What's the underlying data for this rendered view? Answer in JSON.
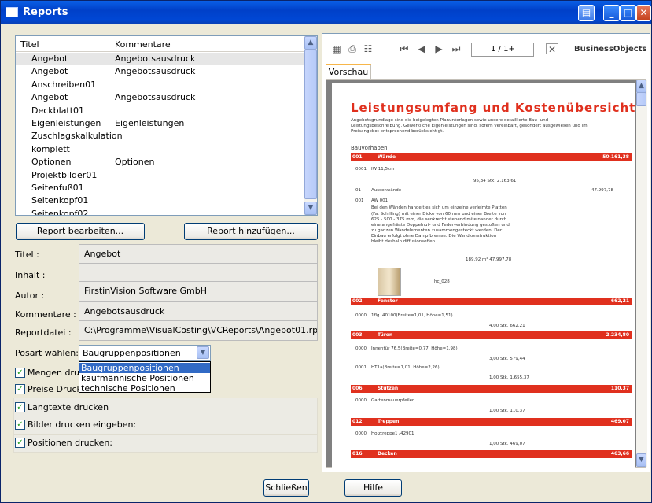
{
  "window": {
    "title": "Reports"
  },
  "list": {
    "col_title": "Titel",
    "col_comment": "Kommentare",
    "rows": [
      {
        "title": "Angebot",
        "comment": "Angebotsausdruck"
      },
      {
        "title": "Angebot",
        "comment": "Angebotsausdruck"
      },
      {
        "title": "Anschreiben01",
        "comment": ""
      },
      {
        "title": "Angebot",
        "comment": "Angebotsausdruck"
      },
      {
        "title": "Deckblatt01",
        "comment": ""
      },
      {
        "title": "Eigenleistungen",
        "comment": "Eigenleistungen"
      },
      {
        "title": "Zuschlagskalkulation",
        "comment": ""
      },
      {
        "title": "komplett",
        "comment": ""
      },
      {
        "title": "Optionen",
        "comment": "Optionen"
      },
      {
        "title": "Projektbilder01",
        "comment": ""
      },
      {
        "title": "Seitenfuß01",
        "comment": ""
      },
      {
        "title": "Seitenkopf01",
        "comment": ""
      },
      {
        "title": "Seitenkopf02",
        "comment": ""
      }
    ]
  },
  "buttons": {
    "edit": "Report bearbeiten...",
    "add": "Report hinzufügen...",
    "close": "Schließen",
    "help": "Hilfe"
  },
  "fields": {
    "title_label": "Titel :",
    "title_value": "Angebot",
    "content_label": "Inhalt :",
    "content_value": "",
    "author_label": "Autor :",
    "author_value": "FirstinVision Software GmbH",
    "comment_label": "Kommentare :",
    "comment_value": "Angebotsausdruck",
    "file_label": "Reportdatei :",
    "file_value": "C:\\Programme\\VisualCosting\\VCReports\\Angebot01.rpt"
  },
  "posart": {
    "label": "Posart wählen:",
    "selected": "Baugruppenpositionen",
    "options": [
      "Baugruppenpositionen",
      "kaufmännische Positionen",
      "technische Positionen"
    ]
  },
  "checkboxes": [
    {
      "label": "Mengen drucken",
      "checked": true
    },
    {
      "label": "Preise Drucken",
      "checked": true
    },
    {
      "label": "Langtexte drucken",
      "checked": true
    },
    {
      "label": "Bilder drucken eingeben:",
      "checked": true
    },
    {
      "label": "Positionen drucken:",
      "checked": true
    }
  ],
  "viewer": {
    "page_box": "1 / 1+",
    "brand": "BusinessObjects",
    "tab": "Vorschau",
    "report": {
      "title": "Leistungsumfang und Kostenübersicht",
      "intro1": "Angebotsgrundlage sind die beigelegten Planunterlagen sowie unsere detaillierte Bau- und",
      "intro2": "Leistungsbeschreibung. Gewerkliche Eigenleistungen sind, sofern vereinbart, gesondert ausgewiesen und im",
      "intro3": "Preisangebot entsprechend berücksichtigt.",
      "section_head": "Bauvorhaben",
      "sections": [
        {
          "no": "001",
          "name": "Wände",
          "sum": "50.161,38"
        },
        {
          "no": "002",
          "name": "Fenster",
          "sum": "662,21"
        },
        {
          "no": "003",
          "name": "Türen",
          "sum": "2.234,80"
        },
        {
          "no": "006",
          "name": "Stützen",
          "sum": "110,37"
        },
        {
          "no": "012",
          "name": "Treppen",
          "sum": "469,07"
        },
        {
          "no": "016",
          "name": "Decken",
          "sum": "463,66"
        }
      ],
      "lines": [
        {
          "a": "0001",
          "b": "IW 11,5cm"
        },
        {
          "a": "",
          "b": "95,34 Stk.        2.163,61"
        },
        {
          "a": "01",
          "b": "Aussenwände"
        },
        {
          "a": "",
          "b": "47.997,78"
        },
        {
          "a": "001",
          "b": "AW 001"
        },
        {
          "a": "",
          "b": "Bei den Wänden handelt es sich um einzelne verleimte Platten"
        },
        {
          "a": "",
          "b": "(Fa. Schilling) mit einer Dicke von 60 mm und einer Breite von"
        },
        {
          "a": "",
          "b": "625 - 500 - 375 mm, die senkrecht stehend miteinander durch"
        },
        {
          "a": "",
          "b": "eine angefräste Doppelnut- und Federverbindung gestoßen und"
        },
        {
          "a": "",
          "b": "zu ganzen Wandelementen zusammengesteckt werden. Der"
        },
        {
          "a": "",
          "b": "Einbau erfolgt ohne Dampfbremse. Die Wandkonstruktion"
        },
        {
          "a": "",
          "b": "bleibt deshalb diffusionsoffen."
        },
        {
          "a": "",
          "b": "189,92 m²        47.997,78"
        },
        {
          "a": "",
          "b": "hc_028"
        },
        {
          "a": "0000",
          "b": "1flg. 40100(Breite=1,01, Höhe=1,51)"
        },
        {
          "a": "",
          "b": "4,00 Stk.        662,21"
        },
        {
          "a": "0000",
          "b": "Innentür 76,5(Breite=0,77, Höhe=1,98)"
        },
        {
          "a": "",
          "b": "3,00 Stk.        579,44"
        },
        {
          "a": "0001",
          "b": "HT1a(Breite=1,01, Höhe=2,26)"
        },
        {
          "a": "",
          "b": "1,00 Stk.        1.655,37"
        },
        {
          "a": "0000",
          "b": "Gartenmauerpfeiler"
        },
        {
          "a": "",
          "b": "1,00 Stk.        110,37"
        },
        {
          "a": "0000",
          "b": "Holztreppe1 /42901"
        },
        {
          "a": "",
          "b": "1,00 Stk.        469,07"
        }
      ]
    }
  },
  "colors": {
    "titlebar": "#0047d4",
    "accent_red": "#e0301e",
    "selection": "#316ac5"
  }
}
